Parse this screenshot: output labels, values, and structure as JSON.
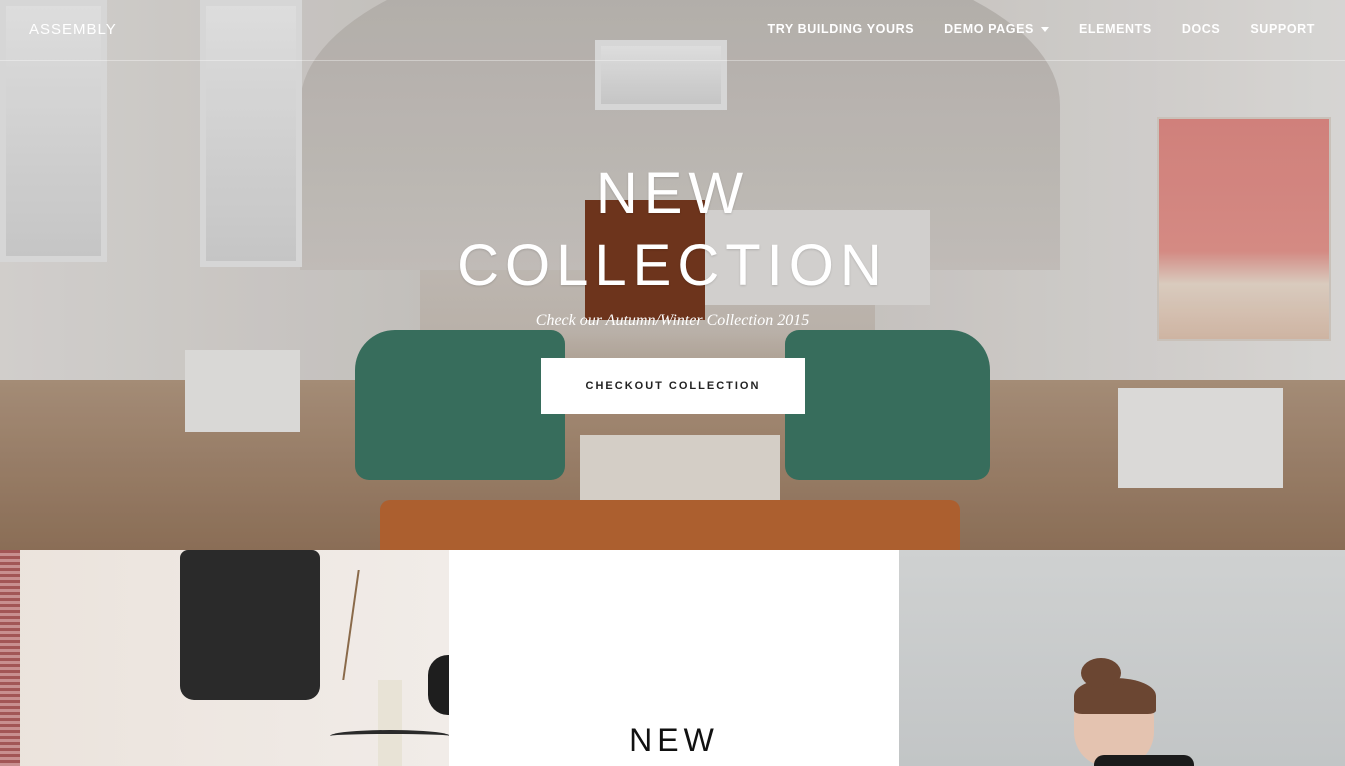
{
  "nav": {
    "brand": "ASSEMBLY",
    "items": [
      {
        "label": "TRY BUILDING YOURS"
      },
      {
        "label": "DEMO PAGES"
      },
      {
        "label": "ELEMENTS"
      },
      {
        "label": "DOCS"
      },
      {
        "label": "SUPPORT"
      }
    ]
  },
  "hero": {
    "title_line1": "NEW",
    "title_line2": "COLLECTION",
    "subtitle": "Check our Autumn/Winter Collection 2015",
    "cta_label": "CHECKOUT COLLECTION"
  },
  "tiles": {
    "middle_title": "NEW"
  }
}
